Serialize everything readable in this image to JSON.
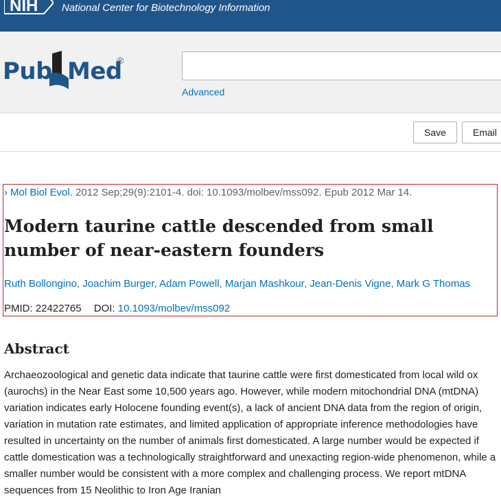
{
  "topbar": {
    "nih_logo": "NIH",
    "title": "National Center for Biotechnology Information"
  },
  "header": {
    "logo_part1": "Pub",
    "logo_part2": "Med",
    "logo_reg": "®",
    "search": {
      "value": "",
      "placeholder": ""
    },
    "advanced_label": "Advanced"
  },
  "actions": {
    "save_label": "Save",
    "email_label": "Email"
  },
  "article": {
    "journal": "Mol Biol Evol.",
    "citation": " 2012 Sep;29(9):2101-4. doi: 10.1093/molbev/mss092. Epub 2012 Mar 14.",
    "title": "Modern taurine cattle descended from small number of near-eastern founders",
    "authors": [
      "Ruth Bollongino",
      "Joachim Burger",
      "Adam Powell",
      "Marjan Mashkour",
      "Jean-Denis Vigne",
      "Mark G Thomas"
    ],
    "pmid_label": "PMID:",
    "pmid": "22422765",
    "doi_label": "DOI:",
    "doi": "10.1093/molbev/mss092"
  },
  "abstract": {
    "heading": "Abstract",
    "text": "Archaeozoological and genetic data indicate that taurine cattle were first domesticated from local wild ox (aurochs) in the Near East some 10,500 years ago. However, while modern mitochondrial DNA (mtDNA) variation indicates early Holocene founding event(s), a lack of ancient DNA data from the region of origin, variation in mutation rate estimates, and limited application of appropriate inference methodologies have resulted in uncertainty on the number of animals first domesticated. A large number would be expected if cattle domestication was a technologically straightforward and unexacting region-wide phenomenon, while a smaller number would be consistent with a more complex and challenging process. We report mtDNA sequences from 15 Neolithic to Iron Age Iranian"
  },
  "colors": {
    "topbar": "#20558a",
    "link": "#0071bc",
    "highlight_border": "#c0272d"
  }
}
